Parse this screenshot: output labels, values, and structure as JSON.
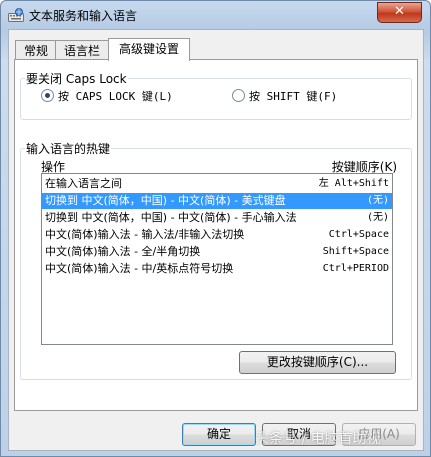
{
  "window": {
    "title": "文本服务和输入语言",
    "close_label": "✕",
    "title_icon": "keyboard-globe-icon"
  },
  "tabs": [
    {
      "label": "常规",
      "active": false
    },
    {
      "label": "语言栏",
      "active": false
    },
    {
      "label": "高级键设置",
      "active": true
    }
  ],
  "caps_lock": {
    "group_label": "要关闭 Caps Lock",
    "options": [
      {
        "label": "按 CAPS LOCK 键(L)",
        "checked": true
      },
      {
        "label": "按 SHIFT 键(F)",
        "checked": false
      }
    ]
  },
  "hotkeys": {
    "group_label": "输入语言的热键",
    "columns": {
      "operation": "操作",
      "key_sequence": "按键顺序(K)"
    },
    "rows": [
      {
        "operation": "在输入语言之间",
        "key": "左 Alt+Shift",
        "selected": false
      },
      {
        "operation": "切换到 中文(简体，中国) - 中文(简体) - 美式键盘",
        "key": "(无)",
        "selected": true
      },
      {
        "operation": "切换到 中文(简体，中国) - 中文(简体) - 手心输入法",
        "key": "(无)",
        "selected": false
      },
      {
        "operation": "中文(简体)输入法 - 输入法/非输入法切换",
        "key": "Ctrl+Space",
        "selected": false
      },
      {
        "operation": "中文(简体)输入法 - 全/半角切换",
        "key": "Shift+Space",
        "selected": false
      },
      {
        "operation": "中文(简体)输入法 - 中/英标点符号切换",
        "key": "Ctrl+PERIOD",
        "selected": false
      }
    ],
    "change_button": "更改按键顺序(C)..."
  },
  "buttons": {
    "ok": "确定",
    "cancel": "取消",
    "apply": "应用(A)"
  },
  "watermark": "头条号 / 电脑首助视"
}
